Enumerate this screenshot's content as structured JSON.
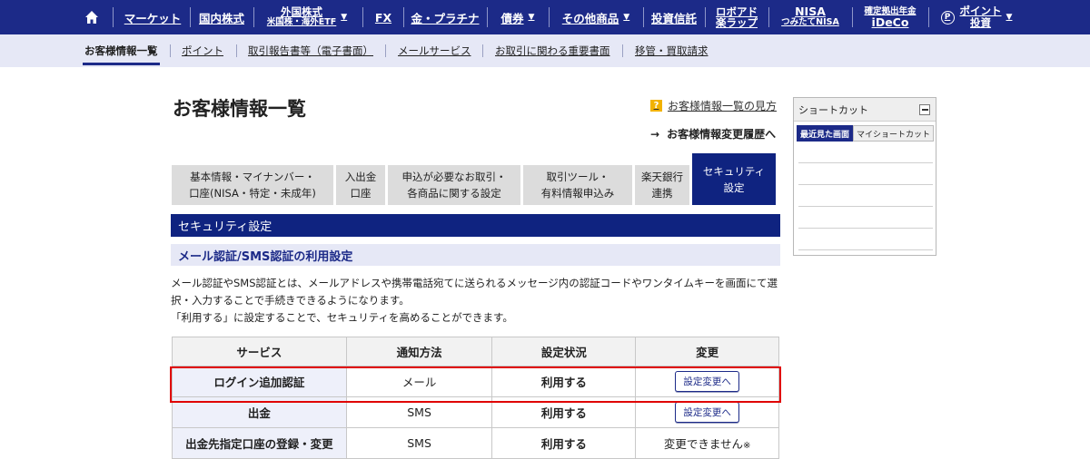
{
  "topnav": {
    "items": [
      {
        "label": "マーケット"
      },
      {
        "label": "国内株式"
      },
      {
        "line1": "外国株式",
        "line2": "米国株・海外ETF"
      },
      {
        "label": "FX"
      },
      {
        "label": "金・プラチナ"
      },
      {
        "label": "債券"
      },
      {
        "label": "その他商品"
      },
      {
        "label": "投資信託"
      },
      {
        "line1": "ロボアド",
        "line2": "楽ラップ"
      },
      {
        "line1": "NISA",
        "line2": "つみたてNISA"
      },
      {
        "line1": "確定拠出年金",
        "line2": "iDeCo"
      },
      {
        "line1": "ポイント",
        "line2": "投資"
      }
    ],
    "caret": "▼"
  },
  "subnav": {
    "items": [
      {
        "label": "お客様情報一覧"
      },
      {
        "label": "ポイント"
      },
      {
        "label": "取引報告書等（電子書面）"
      },
      {
        "label": "メールサービス"
      },
      {
        "label": "お取引に関わる重要書面"
      },
      {
        "label": "移管・買取請求"
      }
    ]
  },
  "main": {
    "title": "お客様情報一覧",
    "help_icon": "?",
    "help_link": "お客様情報一覧の見方",
    "history_arrow": "→",
    "history_link": "お客様情報変更履歴へ",
    "tabs": [
      {
        "line1": "基本情報・マイナンバー・",
        "line2": "口座(NISA・特定・未成年)"
      },
      {
        "line1": "入出金",
        "line2": "口座"
      },
      {
        "line1": "申込が必要なお取引・",
        "line2": "各商品に関する設定"
      },
      {
        "line1": "取引ツール・",
        "line2": "有料情報申込み"
      },
      {
        "line1": "楽天銀行",
        "line2": "連携"
      },
      {
        "line1": "セキュリティ",
        "line2": "設定"
      }
    ],
    "section_title": "セキュリティ設定",
    "subsection_title": "メール認証/SMS認証の利用設定",
    "desc_line1": "メール認証やSMS認証とは、メールアドレスや携帯電話宛てに送られるメッセージ内の認証コードやワンタイムキーを画面にて選",
    "desc_line2": "択・入力することで手続きできるようになります。",
    "desc_line3": "「利用する」に設定することで、セキュリティを高めることができます。"
  },
  "table": {
    "headers": [
      "サービス",
      "通知方法",
      "設定状況",
      "変更"
    ],
    "rows": [
      {
        "service": "ログイン追加認証",
        "method": "メール",
        "status": "利用する",
        "action": "設定変更へ"
      },
      {
        "service": "出金",
        "method": "SMS",
        "status": "利用する",
        "action": "設定変更へ"
      },
      {
        "service": "出金先指定口座の登録・変更",
        "method": "SMS",
        "status": "利用する",
        "action": "変更できません",
        "note": "※"
      }
    ]
  },
  "shortcut": {
    "title": "ショートカット",
    "tabs": [
      "最近見た画面",
      "マイショートカット"
    ]
  },
  "colors": {
    "nav_blue": "#1c2a88",
    "section_blue": "#0f2380",
    "subnav_bg": "#e6e8f6",
    "highlight_red": "#e00000"
  }
}
